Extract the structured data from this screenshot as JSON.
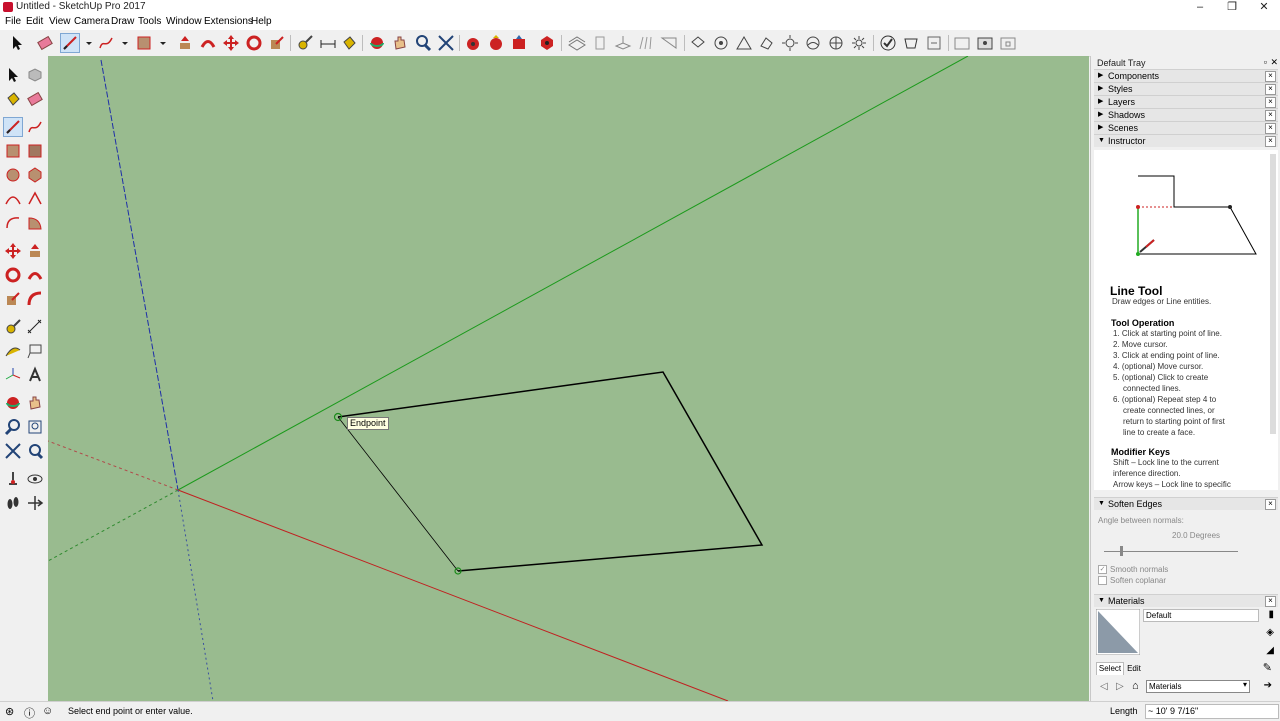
{
  "window": {
    "title": "Untitled - SketchUp Pro 2017",
    "minimize": "–",
    "maximize": "❐",
    "close": "✕"
  },
  "menu": [
    "File",
    "Edit",
    "View",
    "Camera",
    "Draw",
    "Tools",
    "Window",
    "Extensions",
    "Help"
  ],
  "viewport": {
    "tooltip": "Endpoint",
    "background": "#99bb8f"
  },
  "tray": {
    "title": "Default Tray",
    "panels": [
      "Components",
      "Styles",
      "Layers",
      "Shadows",
      "Scenes",
      "Instructor"
    ],
    "instructor": {
      "tool_name": "Line Tool",
      "tool_desc": "Draw edges or Line entities.",
      "op_heading": "Tool Operation",
      "steps": [
        "1. Click at starting point of line.",
        "2. Move cursor.",
        "3. Click at ending point of line.",
        "4. (optional) Move cursor.",
        "5. (optional) Click to create",
        "connected lines.",
        "6. (optional) Repeat step 4 to",
        "create connected lines, or",
        "return to starting point of first",
        "line to create a face."
      ],
      "mod_heading": "Modifier Keys",
      "mods": [
        "Shift – Lock line to the current",
        "inference direction.",
        "Arrow keys – Lock line to specific"
      ]
    },
    "soften": {
      "label": "Soften Edges",
      "angle_label": "Angle between normals:",
      "angle_value": "20.0  Degrees",
      "smooth": "Smooth normals",
      "coplanar": "Soften coplanar"
    },
    "materials": {
      "label": "Materials",
      "name": "Default",
      "tab_select": "Select",
      "tab_edit": "Edit",
      "library": "Materials"
    }
  },
  "status": {
    "message": "Select end point or enter value.",
    "measure_label": "Length",
    "measure_value": "~ 10' 9 7/16\""
  }
}
